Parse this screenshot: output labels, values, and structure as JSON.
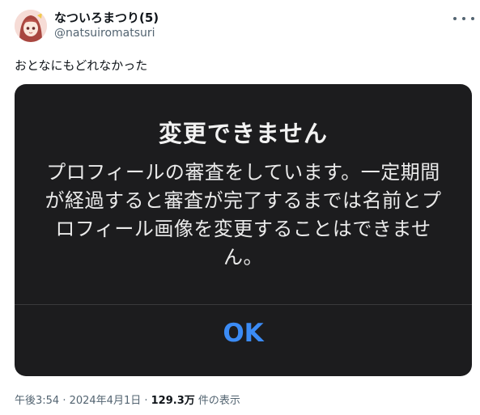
{
  "tweet": {
    "display_name": "なついろまつり(5)",
    "handle": "@natsuiromatsuri",
    "text": "おとなにもどれなかった",
    "timestamp": "午後3:54 · 2024年4月1日 · ",
    "views_count": "129.3万",
    "views_label": " 件の表示",
    "more_icon": "more-horizontal-icon"
  },
  "alert": {
    "title": "変更できません",
    "message": "プロフィールの審査をしています。一定期間が経過すると審査が完了するまでは名前とプロフィール画像を変更することはできません。",
    "ok_label": "OK"
  },
  "colors": {
    "alert_background": "#1c1c1e",
    "alert_button": "#3b8bf5",
    "text_primary": "#0f1419",
    "text_secondary": "#536471"
  }
}
